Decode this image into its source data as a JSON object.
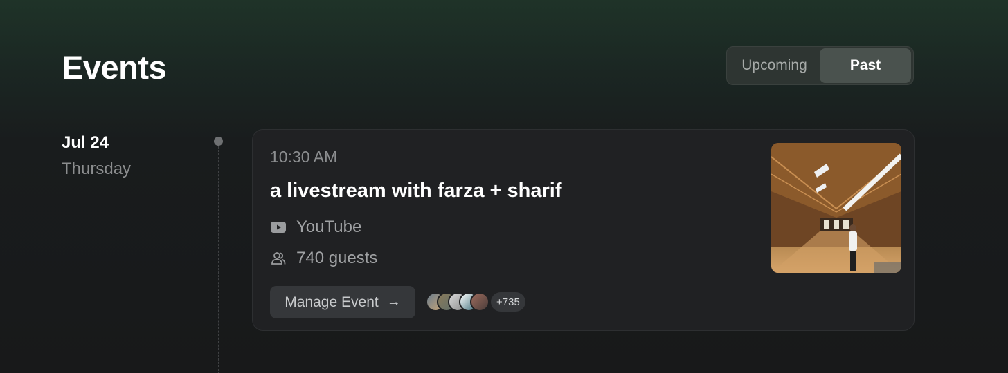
{
  "header": {
    "title": "Events",
    "tabs": [
      {
        "label": "Upcoming",
        "selected": false
      },
      {
        "label": "Past",
        "selected": true
      }
    ]
  },
  "event": {
    "date": "Jul 24",
    "weekday": "Thursday",
    "time": "10:30 AM",
    "title": "a livestream with farza + sharif",
    "platform": "YouTube",
    "platform_icon": "youtube-icon",
    "guests": "740 guests",
    "guests_icon": "users-icon",
    "manage_label": "Manage Event",
    "manage_icon": "arrow-right-icon",
    "avatar_overflow": "+735",
    "thumbnail_icon": "event-cover-image"
  },
  "colors": {
    "selected_tab_bg": "#4a524e",
    "card_bg": "#202123",
    "muted_text": "#8c8e90"
  }
}
